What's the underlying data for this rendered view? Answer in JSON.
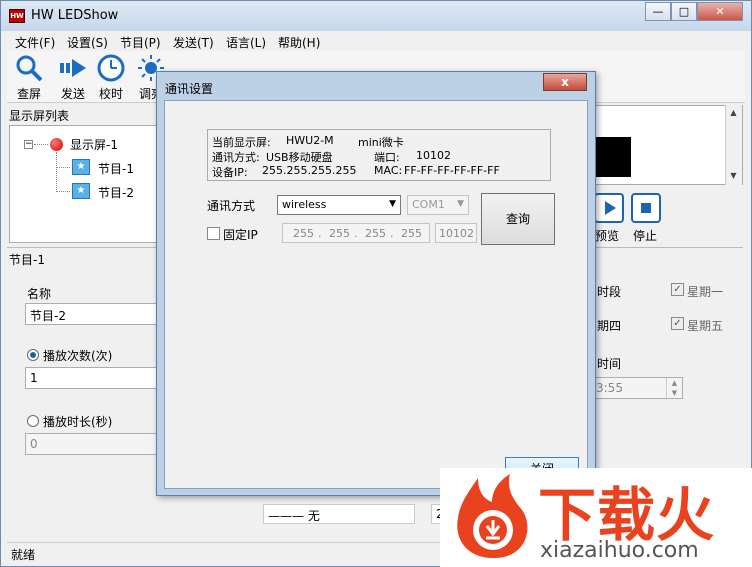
{
  "app": {
    "title": "HW LEDShow",
    "logo_text": "HW"
  },
  "window_controls": {
    "minimize": "—",
    "maximize": "□",
    "close": "✕"
  },
  "menu": [
    "文件(F)",
    "设置(S)",
    "节目(P)",
    "发送(T)",
    "语言(L)",
    "帮助(H)"
  ],
  "toolbar": [
    {
      "label": "查屏",
      "icon": "magnifier-icon"
    },
    {
      "label": "发送",
      "icon": "send-arrow-icon"
    },
    {
      "label": "校时",
      "icon": "clock-icon"
    },
    {
      "label": "调亮",
      "icon": "brightness-icon"
    }
  ],
  "screen_list": {
    "header": "显示屏列表",
    "expander": "−",
    "screen": "显示屏-1",
    "programs": [
      "节目-1",
      "节目-2"
    ]
  },
  "right_panel": {
    "preview": "预览",
    "stop": "停止",
    "time_period": "时段",
    "weekdays": [
      "星期一",
      "期四",
      "星期五"
    ],
    "time_label": "时间",
    "time_value": "3:55"
  },
  "program_section": {
    "header": "节目-1",
    "name_label": "名称",
    "name_value": "节目-2",
    "play_count_label": "播放次数(次)",
    "play_count_value": "1",
    "play_duration_label": "播放时长(秒)",
    "play_duration_value": "0"
  },
  "bottom": {
    "line_style": "——— 无",
    "number_fragment": "2"
  },
  "status": {
    "text": "就绪"
  },
  "dialog": {
    "title": "通讯设置",
    "close_label": "x",
    "info": {
      "current_screen_label": "当前显示屏:",
      "current_screen_value": "HWU2-M",
      "card_type": "mini微卡",
      "comm_method_label": "通讯方式:",
      "comm_method_value": "USB移动硬盘",
      "port_label": "端口:",
      "port_value": "10102",
      "device_ip_label": "设备IP:",
      "device_ip_value": "255.255.255.255",
      "mac_label": "MAC:",
      "mac_value": "FF-FF-FF-FF-FF-FF"
    },
    "comm_select_label": "通讯方式",
    "comm_select_value": "wireless",
    "com_port_value": "COM1",
    "query_button": "查询",
    "fixed_ip_label": "固定IP",
    "ip_octets": [
      "255",
      "255",
      "255",
      "255"
    ],
    "ip_port": "10102",
    "close_button": "关闭"
  },
  "watermark": {
    "brand_cn": "下载火",
    "brand_url": "xiazaihuo.com"
  }
}
